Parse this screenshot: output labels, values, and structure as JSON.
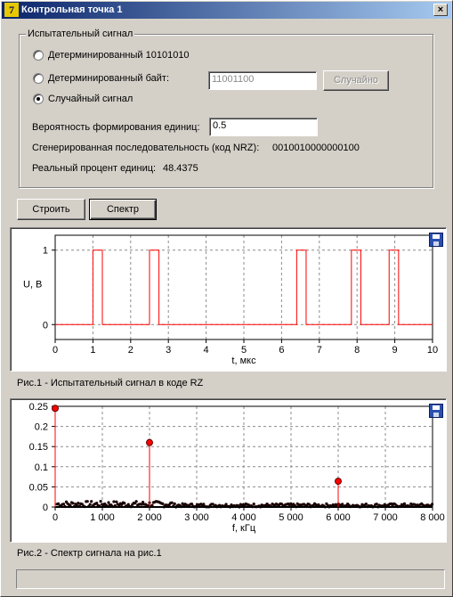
{
  "window": {
    "title": "Контрольная точка 1",
    "app_icon_text": "7",
    "close_label": "×"
  },
  "group": {
    "title": "Испытательный сигнал",
    "radio_options": [
      {
        "label": "Детерминированный 10101010",
        "selected": false
      },
      {
        "label": "Детерминированный байт:",
        "selected": false
      },
      {
        "label": "Случайный сигнал",
        "selected": true
      }
    ],
    "byte_input_value": "11001100",
    "random_button": "Случайно",
    "probability_label": "Вероятность формирования единиц:",
    "probability_value": "0.5",
    "sequence_label": "Сгенерированная последовательность (код NRZ):",
    "sequence_value": "0010010000000100",
    "percent_label": "Реальный процент единиц:",
    "percent_value": "48.4375"
  },
  "buttons": {
    "build": "Строить",
    "spectrum": "Спектр"
  },
  "chart1": {
    "caption": "Рис.1 - Испытательный сигнал в коде RZ"
  },
  "chart2": {
    "caption": "Рис.2 - Спектр сигнала на рис.1"
  },
  "chart_data": [
    {
      "type": "line",
      "xlabel": "t, мкс",
      "ylabel": "U, В",
      "xlim": [
        0,
        10
      ],
      "ylim": [
        -0.2,
        1.2
      ],
      "x_ticks": [
        "0",
        "1",
        "2",
        "3",
        "4",
        "5",
        "6",
        "7",
        "8",
        "9",
        "10"
      ],
      "y_ticks": [
        "0",
        "1"
      ],
      "grid": true,
      "line_color": "#ff0000",
      "pulses": [
        [
          1.0,
          1.25
        ],
        [
          2.5,
          2.75
        ],
        [
          6.4,
          6.65
        ],
        [
          7.85,
          8.1
        ],
        [
          8.85,
          9.1
        ]
      ],
      "t_end": 10
    },
    {
      "type": "scatter",
      "xlabel": "f, кГц",
      "xlim": [
        0,
        8000
      ],
      "ylim": [
        0,
        0.25
      ],
      "x_ticks": [
        "0",
        "1 000",
        "2 000",
        "3 000",
        "4 000",
        "5 000",
        "6 000",
        "7 000",
        "8 000"
      ],
      "y_ticks": [
        "0",
        "0.05",
        "0.1",
        "0.15",
        "0.2",
        "0.25"
      ],
      "grid": true,
      "stem_color": "#ff0000",
      "peaks": [
        {
          "f": 0,
          "a": 0.245
        },
        {
          "f": 2000,
          "a": 0.16
        },
        {
          "f": 6000,
          "a": 0.064
        }
      ],
      "noise_level": 0.012
    }
  ]
}
